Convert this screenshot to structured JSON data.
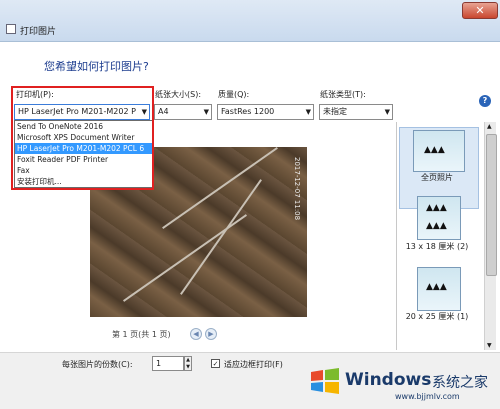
{
  "window": {
    "title": "打印图片",
    "close_label": "✕"
  },
  "heading": "您希望如何打印图片?",
  "controls": {
    "printer_label": "打印机(P):",
    "printer_value": "HP LaserJet Pro M201-M202 P",
    "paper_size_label": "纸张大小(S):",
    "paper_size_value": "A4",
    "quality_label": "质量(Q):",
    "quality_value": "FastRes 1200",
    "paper_type_label": "纸张类型(T):",
    "paper_type_value": "未指定",
    "help_label": "?"
  },
  "printer_options": [
    "Send To OneNote 2016",
    "Microsoft XPS Document Writer",
    "HP LaserJet Pro M201-M202 PCL 6",
    "Foxit Reader PDF Printer",
    "Fax",
    "安装打印机..."
  ],
  "selected_printer_index": 2,
  "preview": {
    "photo_stamp": "2017-12-07 11:08",
    "page_text": "第 1 页(共 1 页)"
  },
  "thumbnails": [
    {
      "label": "全页照片",
      "selected": true
    },
    {
      "label": "13 x 18 厘米 (2)"
    },
    {
      "label": "20 x 25 厘米 (1)"
    }
  ],
  "footer": {
    "copies_label": "每张图片的份数(C):",
    "copies_value": "1",
    "fit_label": "适应边框打印(F)",
    "fit_checked": true
  },
  "watermark": {
    "brand": "Windows",
    "cn": "系统之家",
    "url": "www.bjjmlv.com"
  }
}
